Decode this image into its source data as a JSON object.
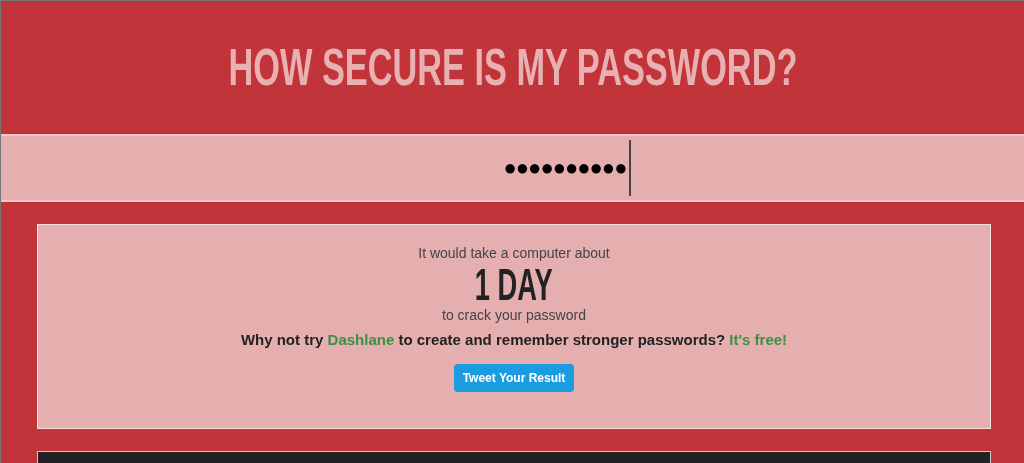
{
  "title": "HOW SECURE IS MY PASSWORD?",
  "password_field": {
    "value": "●●●●●●●●●●"
  },
  "result": {
    "intro": "It would take a computer about",
    "time": "1 DAY",
    "outro": "to crack your password",
    "promo": [
      {
        "kind": "text",
        "text": "Why not try "
      },
      {
        "kind": "link",
        "text": "Dashlane"
      },
      {
        "kind": "text",
        "text": " to create and remember stronger passwords? "
      },
      {
        "kind": "link",
        "text": "It's free!"
      }
    ],
    "button": "Tweet Your Result"
  }
}
